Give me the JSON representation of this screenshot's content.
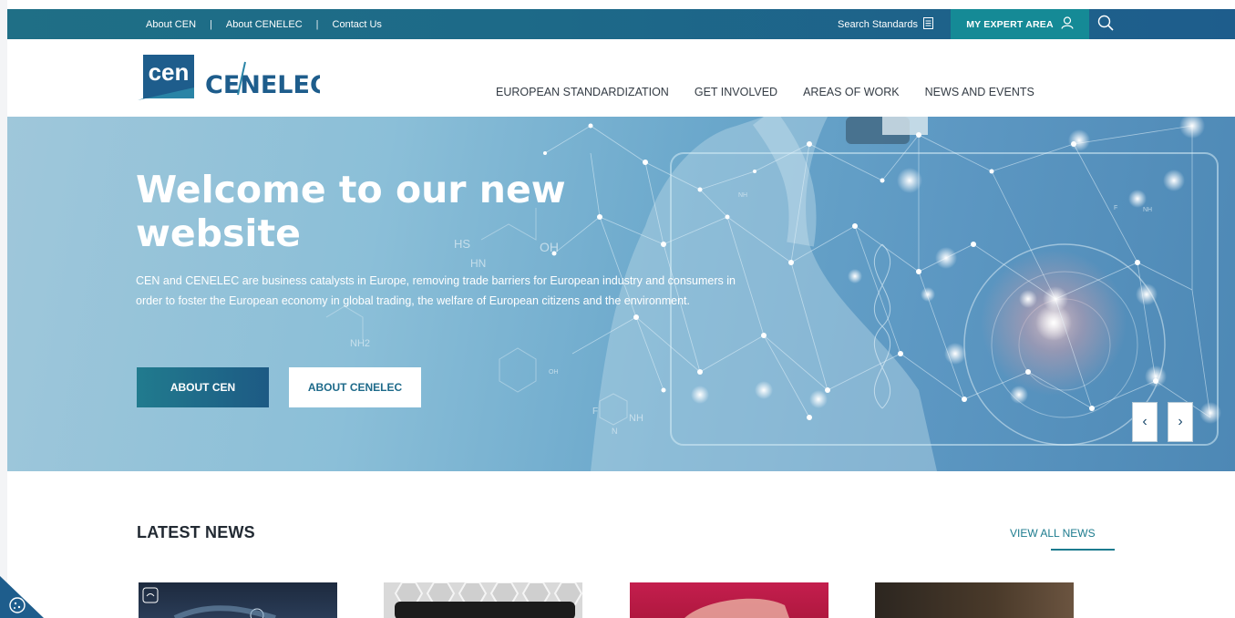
{
  "topbar": {
    "links": [
      "About CEN",
      "About CENELEC",
      "Contact Us"
    ],
    "separator": "|",
    "search_standards": "Search Standards",
    "expert_area": "MY EXPERT AREA"
  },
  "logo": {
    "cen": "cen",
    "cenelec": "CENELEC"
  },
  "nav": [
    "EUROPEAN STANDARDIZATION",
    "GET INVOLVED",
    "AREAS OF WORK",
    "NEWS AND EVENTS"
  ],
  "hero": {
    "title": "Welcome to our new website",
    "text": "CEN and CENELEC are business catalysts in Europe, removing trade barriers for European industry and consumers in order to foster the European economy in global trading, the welfare of European citizens and the environment.",
    "button_primary": "ABOUT CEN",
    "button_secondary": "ABOUT CENELEC",
    "prev": "‹",
    "next": "›",
    "molecule_labels": [
      "HS",
      "OH",
      "HN",
      "NH2",
      "NH",
      "N",
      "F",
      "OH",
      "NH",
      "F",
      "NH"
    ]
  },
  "news": {
    "title": "LATEST NEWS",
    "view_all": "VIEW ALL NEWS"
  },
  "colors": {
    "topbar": "#1e6a88",
    "expert_area": "#158a96",
    "accent": "#1c7b8e",
    "nav_text": "#333b44"
  },
  "icons": [
    "document-icon",
    "user-icon",
    "search-icon",
    "cookie-icon",
    "chevron-left-icon",
    "chevron-right-icon"
  ]
}
